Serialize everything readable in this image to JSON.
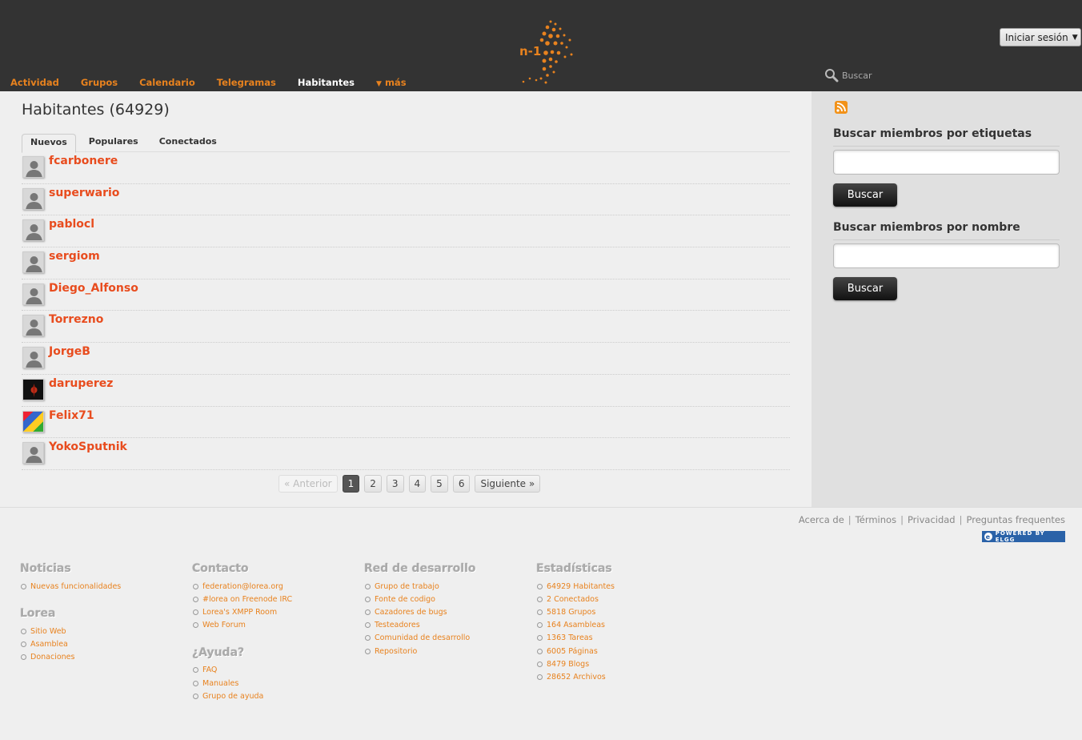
{
  "nav": {
    "items": [
      {
        "label": "Actividad",
        "active": false
      },
      {
        "label": "Grupos",
        "active": false
      },
      {
        "label": "Calendario",
        "active": false
      },
      {
        "label": "Telegramas",
        "active": false
      },
      {
        "label": "Habitantes",
        "active": true
      }
    ],
    "more_label": "más"
  },
  "header": {
    "logo_text": "n-1",
    "login_label": "Iniciar sesión",
    "search_placeholder": "Buscar",
    "brand_color": "#e8821e"
  },
  "main": {
    "title": "Habitantes (64929)",
    "tabs": [
      {
        "label": "Nuevos",
        "active": true
      },
      {
        "label": "Populares",
        "active": false
      },
      {
        "label": "Conectados",
        "active": false
      }
    ],
    "members": [
      {
        "name": "fcarbonere",
        "avatar": "default"
      },
      {
        "name": "superwario",
        "avatar": "default"
      },
      {
        "name": "pablocl",
        "avatar": "default"
      },
      {
        "name": "sergiom",
        "avatar": "default"
      },
      {
        "name": "Diego_Alfonso",
        "avatar": "default"
      },
      {
        "name": "Torrezno",
        "avatar": "default"
      },
      {
        "name": "JorgeB",
        "avatar": "default"
      },
      {
        "name": "daruperez",
        "avatar": "dark"
      },
      {
        "name": "Felix71",
        "avatar": "colorful"
      },
      {
        "name": "YokoSputnik",
        "avatar": "default"
      }
    ],
    "pagination": {
      "prev": "« Anterior",
      "pages": [
        "1",
        "2",
        "3",
        "4",
        "5",
        "6"
      ],
      "current": "1",
      "next": "Siguiente »"
    }
  },
  "sidebar": {
    "tag_search_title": "Buscar miembros por etiquetas",
    "tag_search_button": "Buscar",
    "name_search_title": "Buscar miembros por nombre",
    "name_search_button": "Buscar"
  },
  "footer": {
    "links": [
      "Acerca de",
      "Términos",
      "Privacidad",
      "Preguntas frequentes"
    ],
    "powered": "POWERED BY ELGG",
    "columns": {
      "noticias": {
        "title": "Noticias",
        "items": [
          "Nuevas funcionalidades"
        ]
      },
      "lorea": {
        "title": "Lorea",
        "items": [
          "Sitio Web",
          "Asamblea",
          "Donaciones"
        ]
      },
      "contacto": {
        "title": "Contacto",
        "items": [
          "federation@lorea.org",
          "#lorea on Freenode IRC",
          "Lorea's XMPP Room",
          "Web Forum"
        ]
      },
      "ayuda": {
        "title": "¿Ayuda?",
        "items": [
          "FAQ",
          "Manuales",
          "Grupo de ayuda"
        ]
      },
      "red": {
        "title": "Red de desarrollo",
        "items": [
          "Grupo de trabajo",
          "Fonte de codigo",
          "Cazadores de bugs",
          "Testeadores",
          "Comunidad de desarrollo",
          "Repositorio"
        ]
      },
      "estadisticas": {
        "title": "Estadísticas",
        "items": [
          "64929 Habitantes",
          "2 Conectados",
          "5818 Grupos",
          "164 Asambleas",
          "1363 Tareas",
          "6005 Páginas",
          "8479 Blogs",
          "28652 Archivos"
        ]
      }
    }
  }
}
